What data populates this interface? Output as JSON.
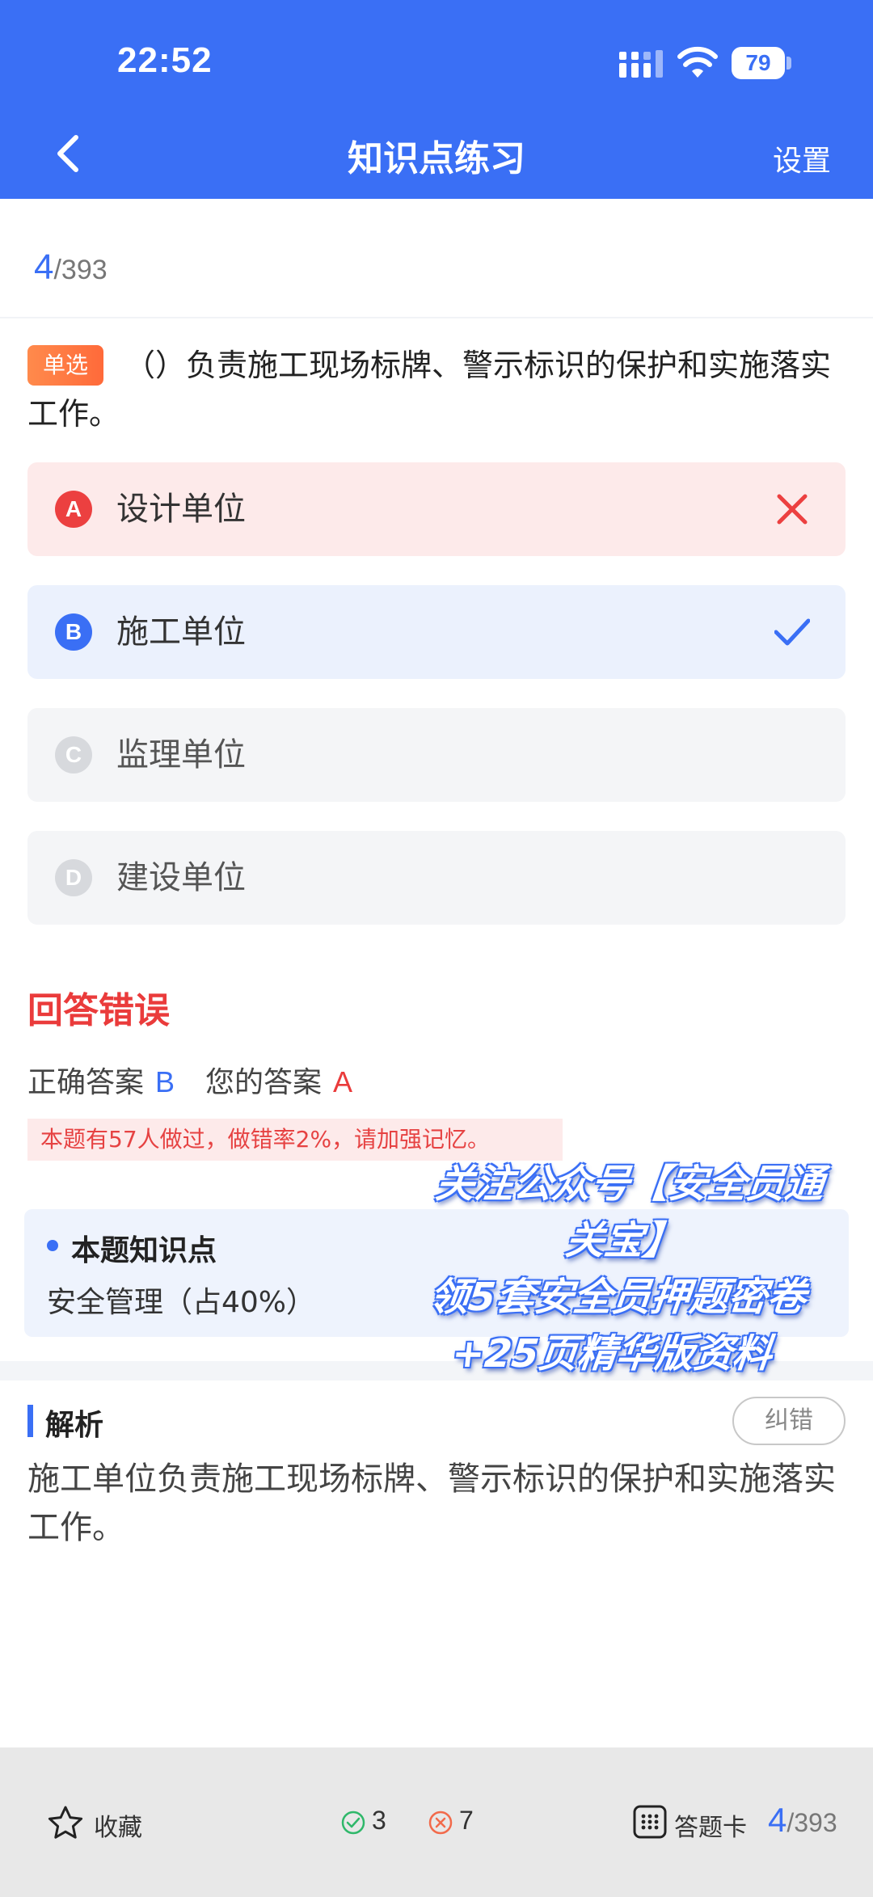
{
  "status_bar": {
    "time": "22:52",
    "battery": "79"
  },
  "nav": {
    "title": "知识点练习",
    "settings_label": "设置"
  },
  "progress": {
    "current": "4",
    "total": "/393"
  },
  "question": {
    "type_badge": "单选",
    "text": "（）负责施工现场标牌、警示标识的保护和实施落实工作。"
  },
  "options": [
    {
      "letter": "A",
      "text": "设计单位",
      "state": "wrong"
    },
    {
      "letter": "B",
      "text": "施工单位",
      "state": "correct"
    },
    {
      "letter": "C",
      "text": "监理单位",
      "state": "none"
    },
    {
      "letter": "D",
      "text": "建设单位",
      "state": "none"
    }
  ],
  "result": {
    "title": "回答错误",
    "correct_label": "正确答案",
    "correct_value": "B",
    "your_label": "您的答案",
    "your_value": "A",
    "stat_tip": "本题有57人做过，做错率2%，请加强记忆。"
  },
  "knowledge": {
    "title": "本题知识点",
    "value": "安全管理（占40%）"
  },
  "promo": {
    "line1": "关注公众号【安全员通",
    "line2": "关宝】",
    "line3": "领5套安全员押题密卷",
    "line4": "+25页精华版资料"
  },
  "analysis": {
    "title": "解析",
    "report_label": "纠错",
    "text": "施工单位负责施工现场标牌、警示标识的保护和实施落实工作。"
  },
  "bottom_bar": {
    "favorite_label": "收藏",
    "correct_count": "3",
    "wrong_count": "7",
    "answer_card_label": "答题卡",
    "progress_current": "4",
    "progress_total": "/393"
  },
  "colors": {
    "primary": "#3a6ff5",
    "error": "#ea3b3b",
    "badge": "#ff7a40"
  }
}
